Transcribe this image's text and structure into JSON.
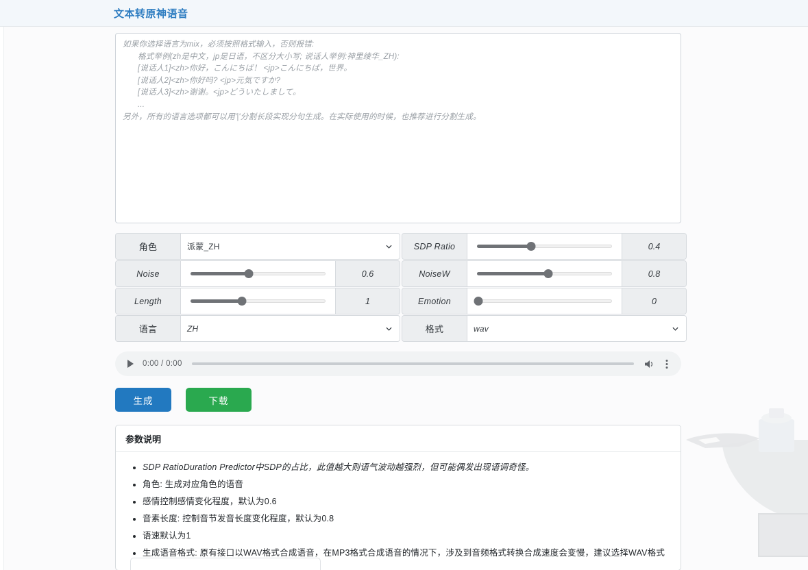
{
  "header": {
    "title": "文本转原神语音"
  },
  "editor": {
    "placeholder_lines": [
      {
        "text": "如果你选择语言为mix，必须按照格式输入，否则报错:",
        "indent": false
      },
      {
        "text": "格式举例(zh是中文，jp是日语，不区分大小写; 说话人举例:神里绫华_ZH):",
        "indent": true
      },
      {
        "text": "[说话人1]<zh>你好，こんにちば！ <jp>こんにちば，世界。",
        "indent": true
      },
      {
        "text": "[说话人2]<zh>你好吗? <jp>元気ですか?",
        "indent": true
      },
      {
        "text": "[说话人3]<zh>谢谢。<jp>どういたしまして。",
        "indent": true
      },
      {
        "text": "...",
        "indent": true
      },
      {
        "text": "另外，所有的语言选项都可以用'|'分割长段实现分句生成。在实际使用的时候，也推荐进行分割生成。",
        "indent": false
      }
    ],
    "value": ""
  },
  "controls": {
    "role": {
      "label": "角色",
      "value": "派蒙_ZH",
      "type": "select"
    },
    "sdp_ratio": {
      "label": "SDP Ratio",
      "value": "0.4",
      "percent": 40,
      "type": "slider"
    },
    "noise": {
      "label": "Noise",
      "value": "0.6",
      "percent": 43,
      "type": "slider"
    },
    "noisew": {
      "label": "NoiseW",
      "value": "0.8",
      "percent": 53,
      "type": "slider"
    },
    "length": {
      "label": "Length",
      "value": "1",
      "percent": 38,
      "type": "slider"
    },
    "emotion": {
      "label": "Emotion",
      "value": "0",
      "percent": 1,
      "type": "slider"
    },
    "language": {
      "label": "语言",
      "value": "ZH",
      "type": "select"
    },
    "format": {
      "label": "格式",
      "value": "wav",
      "type": "select"
    }
  },
  "audio": {
    "play_icon": "play-icon",
    "time": "0:00 / 0:00",
    "volume_icon": "volume-icon",
    "menu_icon": "kebab-menu-icon",
    "progress_percent": 0
  },
  "buttons": {
    "generate": "生成",
    "download": "下载"
  },
  "panel": {
    "title": "参数说明",
    "items": [
      "SDP RatioDuration Predictor中SDP的占比，此值越大则语气波动越强烈，但可能偶发出现语调奇怪。",
      "角色: 生成对应角色的语音",
      "感情控制感情变化程度，默认为0.6",
      "音素长度: 控制音节发音长度变化程度，默认为0.8",
      "语速默认为1",
      "生成语音格式: 原有接口以WAV格式合成语音，在MP3格式合成语音的情况下，涉及到音频格式转换合成速度会变慢，建议选择WAV格式"
    ]
  },
  "colors": {
    "accent": "#2b7bc0",
    "generate": "#2279c0",
    "download": "#2aa94f",
    "slider_fill": "#6f7276"
  }
}
